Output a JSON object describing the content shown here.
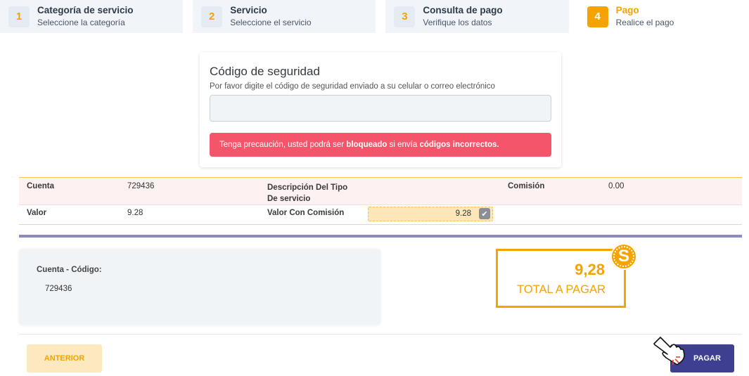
{
  "stepper": [
    {
      "number": "1",
      "title": "Categoría de servicio",
      "subtitle": "Seleccione la categoría"
    },
    {
      "number": "2",
      "title": "Servicio",
      "subtitle": "Seleccione el servicio"
    },
    {
      "number": "3",
      "title": "Consulta de pago",
      "subtitle": "Verifique los datos"
    },
    {
      "number": "4",
      "title": "Pago",
      "subtitle": "Realice el pago"
    }
  ],
  "security": {
    "title": "Código de seguridad",
    "description": "Por favor digite el código de seguridad enviado a su celular o correo electrónico",
    "input_value": "",
    "alert": {
      "part1": "Tenga precaución, usted podrá ser ",
      "bold1": "bloqueado",
      "part2": " si envía ",
      "bold2": "códigos incorrectos",
      "part3": "."
    }
  },
  "details": {
    "cuenta_label": "Cuenta",
    "cuenta_value": "729436",
    "descripcion_label_line1": "Descripción Del Tipo",
    "descripcion_label_line2": "De servicio",
    "comision_label": "Comisión",
    "comision_value": "0.00",
    "valor_label": "Valor",
    "valor_value": "9.28",
    "valor_comision_label": "Valor Con Comisión",
    "valor_comision_value": "9.28"
  },
  "info": {
    "label": "Cuenta - Código:",
    "value": "729436"
  },
  "total": {
    "amount": "9,28",
    "label": "TOTAL A PAGAR",
    "coin_symbol": "S"
  },
  "buttons": {
    "prev": "ANTERIOR",
    "pay": "PAGAR"
  },
  "colors": {
    "accent": "#f5a300",
    "primary": "#3e3f90",
    "alert": "#f5556a"
  },
  "icons": {
    "check": "check-icon",
    "coin": "dollar-coin-icon",
    "cursor": "pointing-hand-icon"
  }
}
